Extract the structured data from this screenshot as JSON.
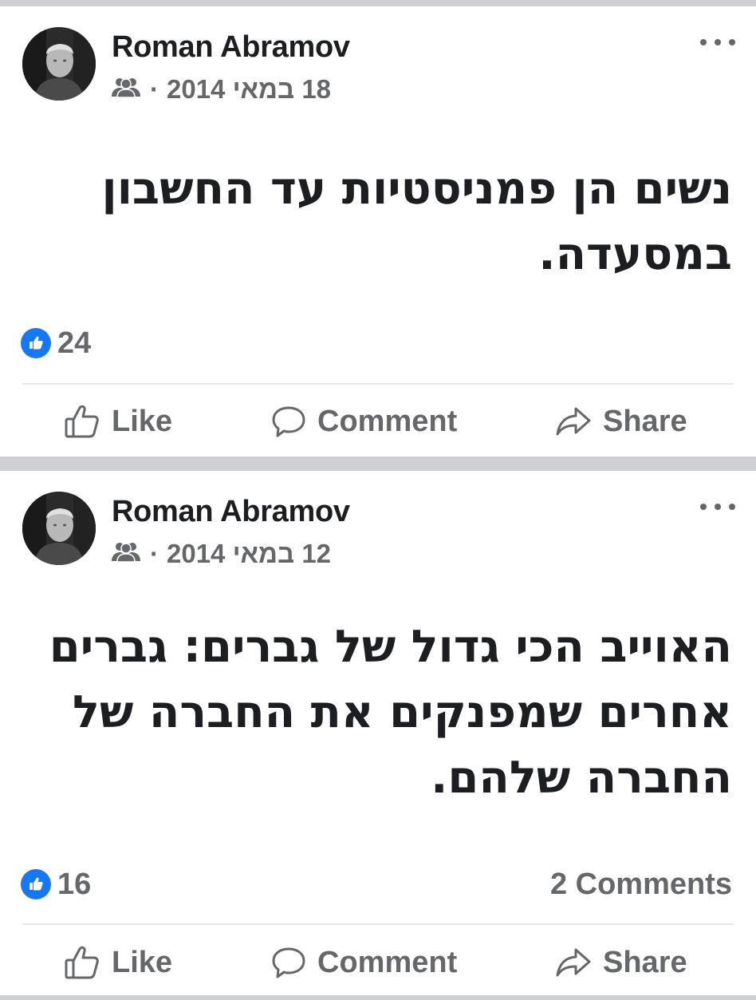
{
  "posts": [
    {
      "author": "Roman Abramov",
      "date": "18 במאי 2014",
      "separator": "·",
      "audience_icon": "friends-icon",
      "text": "נשים הן פמניסטיות עד החשבון במסעדה.",
      "likes": "24",
      "comments": "",
      "actions": {
        "like": "Like",
        "comment": "Comment",
        "share": "Share"
      }
    },
    {
      "author": "Roman Abramov",
      "date": "12 במאי 2014",
      "separator": "·",
      "audience_icon": "friends-icon",
      "text": "האוייב הכי גדול של גברים: גברים אחרים שמפנקים את החברה של החברה שלהם.",
      "likes": "16",
      "comments": "2 Comments",
      "actions": {
        "like": "Like",
        "comment": "Comment",
        "share": "Share"
      }
    }
  ],
  "colors": {
    "background": "#ced0d4",
    "card": "#ffffff",
    "text_primary": "#1c1e21",
    "text_secondary": "#65676b",
    "like_blue": "#1877f2",
    "divider": "#e4e6eb"
  }
}
